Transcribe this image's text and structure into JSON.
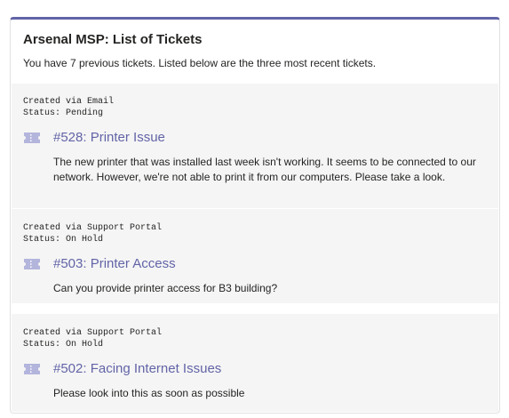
{
  "card": {
    "title": "Arsenal MSP: List of Tickets",
    "subtitle": "You have 7 previous tickets. Listed below are the three most recent tickets.",
    "accent_color": "#6264a7"
  },
  "tickets": [
    {
      "created_via": "Created via Email",
      "status": "Status: Pending",
      "title": "#528: Printer Issue",
      "description": "The new printer that was installed last week isn't working. It seems to be connected to our network. However, we're not able to print it from our computers. Please take a look.",
      "icon": "ticket-icon"
    },
    {
      "created_via": "Created via Support Portal",
      "status": "Status: On Hold",
      "title": "#503: Printer Access",
      "description": "Can you provide printer access for B3 building?",
      "icon": "ticket-icon"
    },
    {
      "created_via": "Created via Support Portal",
      "status": "Status: On Hold",
      "title": "#502: Facing Internet Issues",
      "description": "Please look into this as soon as possible",
      "icon": "ticket-icon"
    }
  ]
}
